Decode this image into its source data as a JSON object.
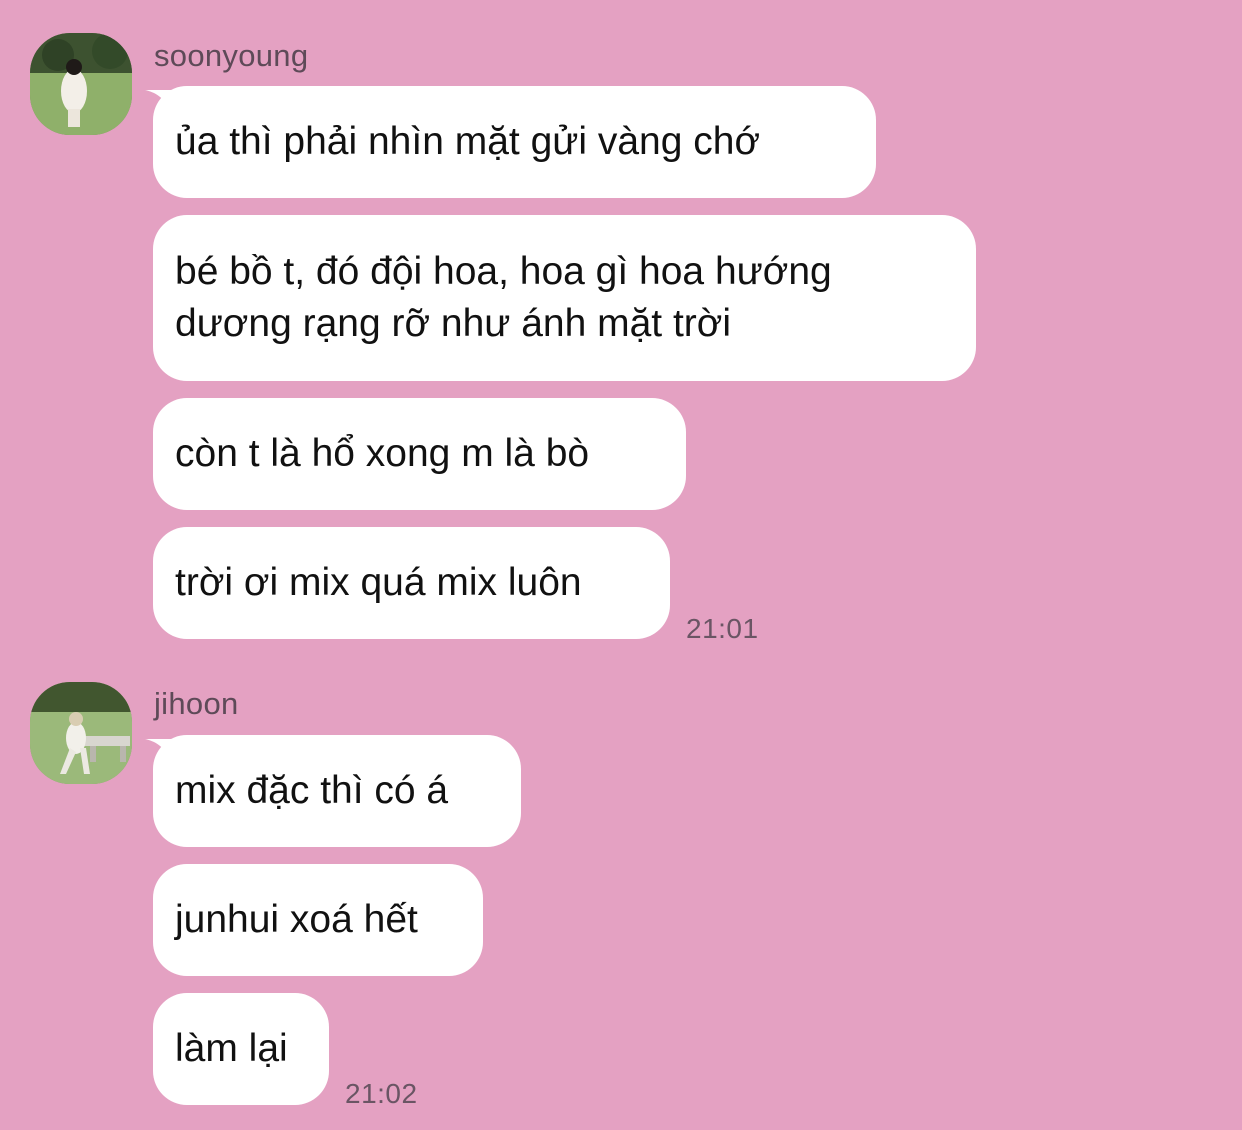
{
  "colors": {
    "background": "#e4a1c2",
    "bubble": "#ffffff",
    "text": "#111111",
    "meta": "#6a5564"
  },
  "groups": [
    {
      "sender": "soonyoung",
      "avatar_icon": "user-avatar-photo",
      "messages": [
        "ủa thì phải nhìn mặt gửi vàng chớ",
        "bé bồ t, đó đội hoa, hoa gì hoa hướng dương rạng rỡ như ánh mặt trời",
        "còn t là hổ xong m là bò",
        "trời ơi mix quá mix luôn"
      ],
      "time": "21:01"
    },
    {
      "sender": "jihoon",
      "avatar_icon": "user-avatar-photo",
      "messages": [
        "mix đặc thì có á",
        "junhui xoá hết",
        "làm lại"
      ],
      "time": "21:02"
    }
  ]
}
